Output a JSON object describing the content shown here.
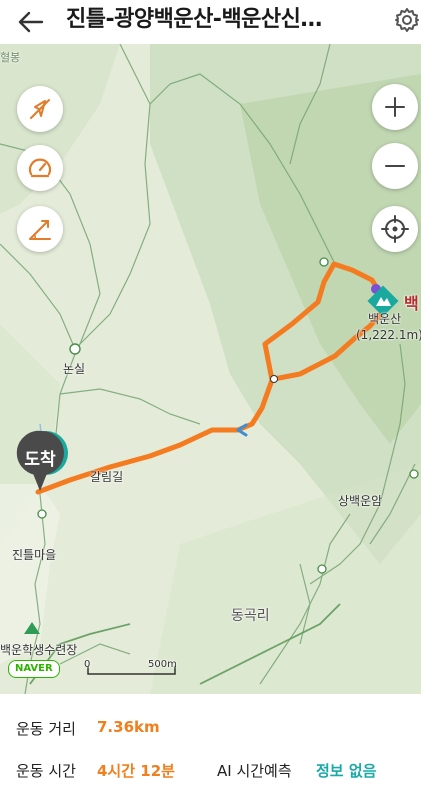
{
  "header": {
    "title": "진틀-광양백운산-백운산신…",
    "back_icon": "arrow-left-icon",
    "settings_icon": "gear-icon"
  },
  "map": {
    "controls_left": [
      "location-off-icon",
      "speedometer-icon",
      "slope-icon"
    ],
    "controls_right": [
      "zoom-in-icon",
      "zoom-out-icon",
      "crosshair-icon"
    ],
    "labels": {
      "top_left": "혈봉",
      "nonsil": "논실",
      "galrimgil": "갈림길",
      "jinteulmaeul": "진틀마을",
      "sangbaegunam": "상백운암",
      "donggokri": "동곡리",
      "campsite": "백운학생수련장",
      "peak_name": "백운산",
      "peak_elevation": "(1,222.1m)",
      "peak_edge": "백"
    },
    "arrival_label": "도착",
    "route_color": "#f47b20",
    "accent_teal": "#1aa99f",
    "map_bg": "#e4ecd9",
    "scale": {
      "zero": "0",
      "distance": "500m"
    },
    "logo": "NAVER"
  },
  "stats": {
    "distance_label": "운동 거리",
    "distance_value": "7.36km",
    "time_label": "운동 시간",
    "time_value": "4시간 12분",
    "ai_label": "AI 시간예측",
    "ai_value": "정보 없음"
  }
}
